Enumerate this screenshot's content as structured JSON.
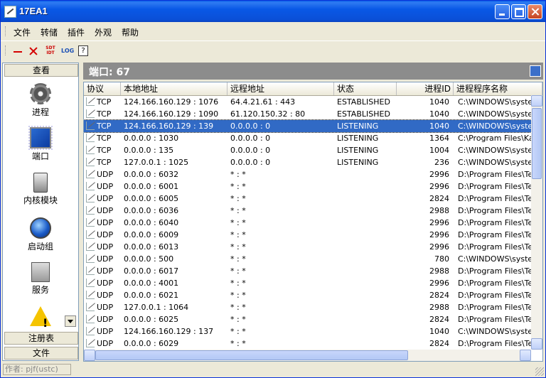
{
  "window": {
    "title": "17EA1"
  },
  "menu": [
    "文件",
    "转储",
    "插件",
    "外观",
    "帮助"
  ],
  "toolbar": {
    "sdt_label": "SDT\nIDT",
    "log_label": "LOG",
    "help_label": "?"
  },
  "sidebar": {
    "top_header": "查看",
    "items": [
      {
        "label": "进程",
        "icon": "gear-icon"
      },
      {
        "label": "端口",
        "icon": "port-icon"
      },
      {
        "label": "内核模块",
        "icon": "chip-icon"
      },
      {
        "label": "启动组",
        "icon": "globe-icon"
      },
      {
        "label": "服务",
        "icon": "computer-icon"
      },
      {
        "label": "",
        "icon": "warning-icon"
      }
    ],
    "bottom_headers": [
      "注册表",
      "文件"
    ]
  },
  "panel": {
    "title": "端口: 67"
  },
  "table": {
    "columns": [
      "协议",
      "本地地址",
      "远程地址",
      "状态",
      "进程ID",
      "进程程序名称"
    ],
    "rows": [
      [
        "TCP",
        "124.166.160.129 : 1076",
        "64.4.21.61 : 443",
        "ESTABLISHED",
        "1040",
        "C:\\WINDOWS\\system"
      ],
      [
        "TCP",
        "124.166.160.129 : 1090",
        "61.120.150.32 : 80",
        "ESTABLISHED",
        "1040",
        "C:\\WINDOWS\\system"
      ],
      [
        "TCP",
        "124.166.160.129 : 139",
        "0.0.0.0 : 0",
        "LISTENING",
        "1040",
        "C:\\WINDOWS\\system"
      ],
      [
        "TCP",
        "0.0.0.0 : 1030",
        "0.0.0.0 : 0",
        "LISTENING",
        "1364",
        "C:\\Program Files\\Kasp"
      ],
      [
        "TCP",
        "0.0.0.0 : 135",
        "0.0.0.0 : 0",
        "LISTENING",
        "1004",
        "C:\\WINDOWS\\system"
      ],
      [
        "TCP",
        "127.0.0.1 : 1025",
        "0.0.0.0 : 0",
        "LISTENING",
        "236",
        "C:\\WINDOWS\\system"
      ],
      [
        "UDP",
        "0.0.0.0 : 6032",
        "* : *",
        "",
        "2996",
        "D:\\Program Files\\Ten"
      ],
      [
        "UDP",
        "0.0.0.0 : 6001",
        "* : *",
        "",
        "2996",
        "D:\\Program Files\\Ten"
      ],
      [
        "UDP",
        "0.0.0.0 : 6005",
        "* : *",
        "",
        "2824",
        "D:\\Program Files\\Ten"
      ],
      [
        "UDP",
        "0.0.0.0 : 6036",
        "* : *",
        "",
        "2988",
        "D:\\Program Files\\Ten"
      ],
      [
        "UDP",
        "0.0.0.0 : 6040",
        "* : *",
        "",
        "2996",
        "D:\\Program Files\\Ten"
      ],
      [
        "UDP",
        "0.0.0.0 : 6009",
        "* : *",
        "",
        "2996",
        "D:\\Program Files\\Ten"
      ],
      [
        "UDP",
        "0.0.0.0 : 6013",
        "* : *",
        "",
        "2996",
        "D:\\Program Files\\Ten"
      ],
      [
        "UDP",
        "0.0.0.0 : 500",
        "* : *",
        "",
        "780",
        "C:\\WINDOWS\\system"
      ],
      [
        "UDP",
        "0.0.0.0 : 6017",
        "* : *",
        "",
        "2988",
        "D:\\Program Files\\Ten"
      ],
      [
        "UDP",
        "0.0.0.0 : 4001",
        "* : *",
        "",
        "2996",
        "D:\\Program Files\\Ten"
      ],
      [
        "UDP",
        "0.0.0.0 : 6021",
        "* : *",
        "",
        "2824",
        "D:\\Program Files\\Ten"
      ],
      [
        "UDP",
        "127.0.0.1 : 1064",
        "* : *",
        "",
        "2988",
        "D:\\Program Files\\Ten"
      ],
      [
        "UDP",
        "0.0.0.0 : 6025",
        "* : *",
        "",
        "2824",
        "D:\\Program Files\\Ten"
      ],
      [
        "UDP",
        "124.166.160.129 : 137",
        "* : *",
        "",
        "1040",
        "C:\\WINDOWS\\system"
      ],
      [
        "UDP",
        "0.0.0.0 : 6029",
        "* : *",
        "",
        "2824",
        "D:\\Program Files\\Ten"
      ]
    ],
    "selected_row": 2
  },
  "status": {
    "author": "作者: pjf(ustc)"
  },
  "colors": {
    "titlebar": "#0958e6",
    "selection": "#316ac5",
    "panel_header": "#8c8c8c",
    "delete_red": "#d40000"
  }
}
